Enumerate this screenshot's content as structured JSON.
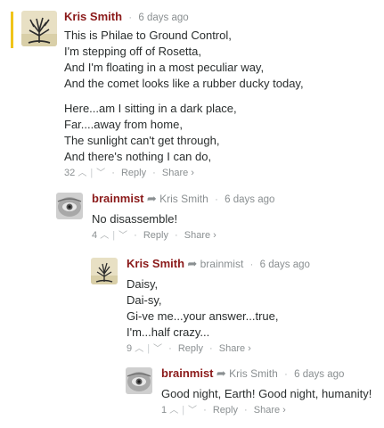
{
  "colors": {
    "accent_bar": "#f0c419",
    "author": "#8b1a1a",
    "meta": "#8a8f91"
  },
  "icons": {
    "reply_arrow": "reply-arrow-icon",
    "upvote": "chevron-up-icon",
    "downvote": "chevron-down-icon",
    "share_caret": "chevron-right-icon"
  },
  "comments": [
    {
      "author": "Kris Smith",
      "reply_to": "",
      "time": "6 days ago",
      "paragraphs": [
        [
          "This is Philae to Ground Control,",
          "I'm stepping off of Rosetta,",
          "And I'm floating in a most peculiar way,",
          "And the comet looks like a rubber ducky today,"
        ],
        [
          "Here...am I sitting in a dark place,",
          "Far....away from home,",
          "The sunlight can't get through,",
          "And there's nothing I can do,"
        ]
      ],
      "votes": "32",
      "reply_label": "Reply",
      "share_label": "Share ›"
    },
    {
      "author": "brainmist",
      "reply_to": "Kris Smith",
      "time": "6 days ago",
      "paragraphs": [
        [
          "No disassemble!"
        ]
      ],
      "votes": "4",
      "reply_label": "Reply",
      "share_label": "Share ›"
    },
    {
      "author": "Kris Smith",
      "reply_to": "brainmist",
      "time": "6 days ago",
      "paragraphs": [
        [
          "Daisy,",
          "Dai-sy,",
          "Gi-ve me...your answer...true,",
          "I'm...half crazy..."
        ]
      ],
      "votes": "9",
      "reply_label": "Reply",
      "share_label": "Share ›"
    },
    {
      "author": "brainmist",
      "reply_to": "Kris Smith",
      "time": "6 days ago",
      "paragraphs": [
        [
          "Good night, Earth! Good night, humanity!"
        ]
      ],
      "votes": "1",
      "reply_label": "Reply",
      "share_label": "Share ›"
    }
  ]
}
